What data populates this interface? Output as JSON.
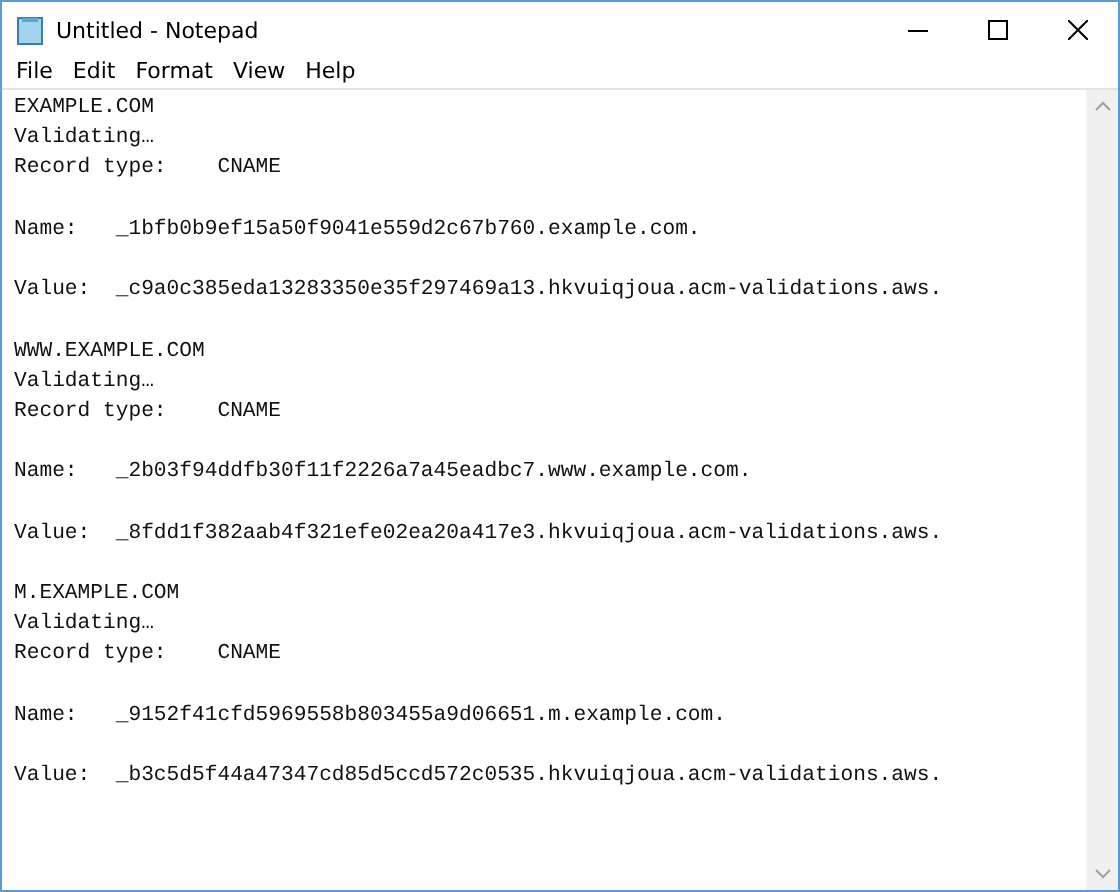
{
  "window": {
    "title": "Untitled - Notepad"
  },
  "menu": [
    "File",
    "Edit",
    "Format",
    "View",
    "Help"
  ],
  "entries": [
    {
      "domain": "EXAMPLE.COM",
      "status": "Validating…",
      "record_type": "Record type:    CNAME",
      "name": "Name:   _1bfb0b9ef15a50f9041e559d2c67b760.example.com.",
      "value": "Value:  _c9a0c385eda13283350e35f297469a13.hkvuiqjoua.acm-validations.aws."
    },
    {
      "domain": "WWW.EXAMPLE.COM",
      "status": "Validating…",
      "record_type": "Record type:    CNAME",
      "name": "Name:   _2b03f94ddfb30f11f2226a7a45eadbc7.www.example.com.",
      "value": "Value:  _8fdd1f382aab4f321efe02ea20a417e3.hkvuiqjoua.acm-validations.aws."
    },
    {
      "domain": "M.EXAMPLE.COM",
      "status": "Validating…",
      "record_type": "Record type:    CNAME",
      "name": "Name:   _9152f41cfd5969558b803455a9d06651.m.example.com.",
      "value": "Value:  _b3c5d5f44a47347cd85d5ccd572c0535.hkvuiqjoua.acm-validations.aws."
    }
  ]
}
